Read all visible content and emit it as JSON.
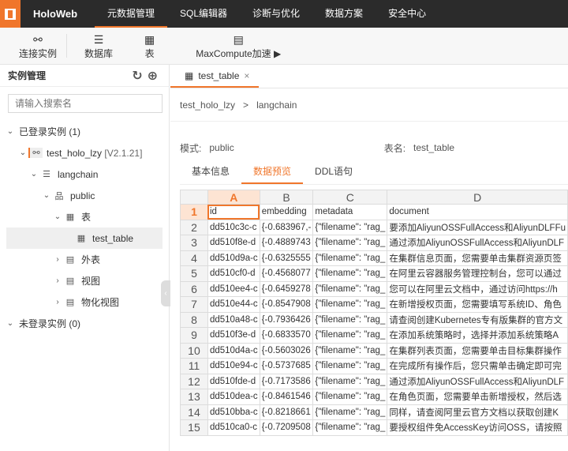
{
  "app": {
    "brand": "HoloWeb",
    "nav": [
      "元数据管理",
      "SQL编辑器",
      "诊断与优化",
      "数据方案",
      "安全中心"
    ]
  },
  "toolbar": {
    "connect": "连接实例",
    "database": "数据库",
    "table": "表",
    "maxcompute": "MaxCompute加速 ▶"
  },
  "sidebar": {
    "title": "实例管理",
    "search_placeholder": "请输入搜索名",
    "logged_in": "已登录实例 (1)",
    "instance": "test_holo_lzy",
    "version": "[V2.1.21]",
    "db": "langchain",
    "schema": "public",
    "tables": "表",
    "table_item": "test_table",
    "foreign": "外表",
    "views": "视图",
    "mviews": "物化视图",
    "logged_out": "未登录实例 (0)"
  },
  "tab": {
    "label": "test_table",
    "close": "×"
  },
  "breadcrumb": {
    "instance": "test_holo_lzy",
    "sep": ">",
    "db": "langchain"
  },
  "meta": {
    "mode_label": "模式:",
    "mode": "public",
    "table_label": "表名:",
    "table": "test_table"
  },
  "subtabs": [
    "基本信息",
    "数据预览",
    "DDL语句"
  ],
  "grid": {
    "cols": [
      "A",
      "B",
      "C",
      "D"
    ],
    "rows": [
      [
        "id",
        "embedding",
        "metadata",
        "document"
      ],
      [
        "dd510c3c-c",
        "{-0.683967,-",
        "{\"filename\": \"rag_",
        "要添加AliyunOSSFullAccess和AliyunDLFFu"
      ],
      [
        "dd510f8e-d",
        "{-0.4889743",
        "{\"filename\": \"rag_",
        "通过添加AliyunOSSFullAccess和AliyunDLF"
      ],
      [
        "dd510d9a-c",
        "{-0.6325555",
        "{\"filename\": \"rag_",
        "在集群信息页面，您需要单击集群资源页签"
      ],
      [
        "dd510cf0-d",
        "{-0.4568077",
        "{\"filename\": \"rag_",
        "在阿里云容器服务管理控制台，您可以通过"
      ],
      [
        "dd510ee4-c",
        "{-0.6459278",
        "{\"filename\": \"rag_",
        "您可以在阿里云文档中，通过访问https://h"
      ],
      [
        "dd510e44-c",
        "{-0.8547908",
        "{\"filename\": \"rag_",
        "在新增授权页面，您需要填写系统ID、角色"
      ],
      [
        "dd510a48-c",
        "{-0.7936426",
        "{\"filename\": \"rag_",
        "请查阅创建Kubernetes专有版集群的官方文"
      ],
      [
        "dd510f3e-d",
        "{-0.6833570",
        "{\"filename\": \"rag_",
        "在添加系统策略时，选择并添加系统策略A"
      ],
      [
        "dd510d4a-c",
        "{-0.5603026",
        "{\"filename\": \"rag_",
        "在集群列表页面，您需要单击目标集群操作"
      ],
      [
        "dd510e94-c",
        "{-0.5737685",
        "{\"filename\": \"rag_",
        "在完成所有操作后，您只需单击确定即可完"
      ],
      [
        "dd510fde-d",
        "{-0.7173586",
        "{\"filename\": \"rag_",
        "通过添加AliyunOSSFullAccess和AliyunDLF"
      ],
      [
        "dd510dea-c",
        "{-0.8461546",
        "{\"filename\": \"rag_",
        "在角色页面，您需要单击新增授权，然后选"
      ],
      [
        "dd510bba-c",
        "{-0.8218661",
        "{\"filename\": \"rag_",
        "同样，请查阅阿里云官方文档以获取创建K"
      ],
      [
        "dd510ca0-c",
        "{-0.7209508",
        "{\"filename\": \"rag_",
        "要授权组件免AccessKey访问OSS，请按照"
      ]
    ]
  }
}
